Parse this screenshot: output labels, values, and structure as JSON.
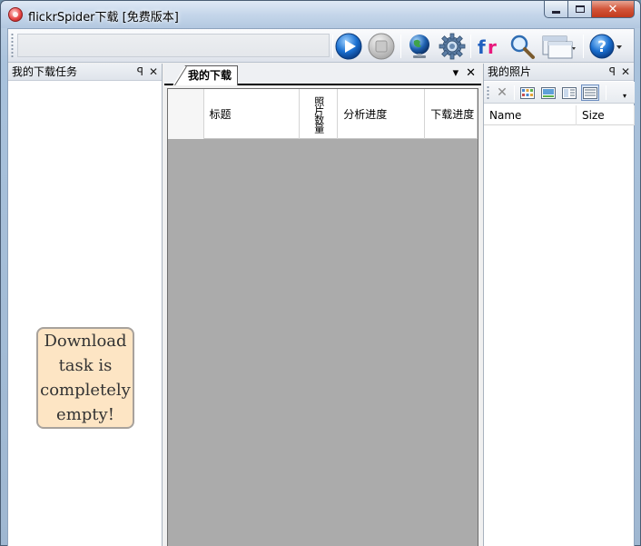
{
  "window": {
    "title": "flickrSpider下载 [免费版本]"
  },
  "toolbar": {
    "url_value": "",
    "buttons": [
      {
        "name": "play-button",
        "icon": "play-icon"
      },
      {
        "name": "stop-button",
        "icon": "stop-icon"
      },
      {
        "name": "globe-button",
        "icon": "globe-icon"
      },
      {
        "name": "settings-button",
        "icon": "gear-icon"
      },
      {
        "name": "flickr-button",
        "icon": "flickr-icon"
      },
      {
        "name": "search-button",
        "icon": "magnifier-icon"
      },
      {
        "name": "window-layout-button",
        "icon": "window-icon"
      },
      {
        "name": "help-button",
        "icon": "help-icon"
      }
    ]
  },
  "left_panel": {
    "title": "我的下载任务",
    "pin": "ᵖ",
    "close": "✕",
    "empty_message": "Download task is completely empty!"
  },
  "center": {
    "tab_label": "我的下载",
    "dropdown": "▾",
    "close": "✕",
    "columns": [
      "标题",
      "照片数量",
      "分析进度",
      "下载进度"
    ]
  },
  "right_panel": {
    "title": "我的照片",
    "pin": "ᵖ",
    "close": "✕",
    "columns": [
      "Name",
      "Size"
    ]
  },
  "colors": {
    "grid_background": "#ababab",
    "note_background": "#fde5c4",
    "accent_blue": "#1a6fd0"
  }
}
